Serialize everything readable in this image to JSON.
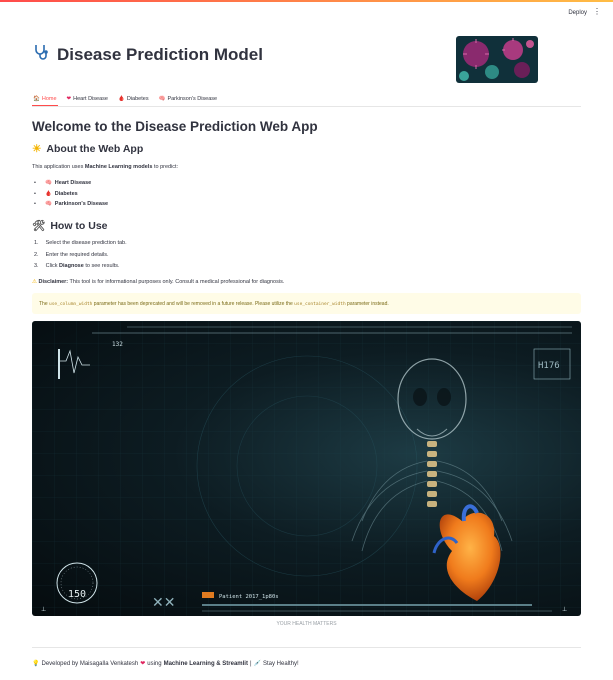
{
  "app": {
    "deploy_label": "Deploy",
    "menu_icon": "kebab-menu-icon",
    "title": "Disease Prediction Model",
    "title_icon": "stethoscope-icon"
  },
  "tabs": [
    {
      "label": "Home",
      "icon": "house-icon",
      "active": true
    },
    {
      "label": "Heart Disease",
      "icon": "heart-icon"
    },
    {
      "label": "Diabetes",
      "icon": "drop-icon"
    },
    {
      "label": "Parkinson's Disease",
      "icon": "brain-icon"
    }
  ],
  "main": {
    "heading": "Welcome to the Disease Prediction Web App",
    "about_heading": "About the Web App",
    "intro_prefix": "This application uses ",
    "intro_bold": "Machine Learning models",
    "intro_suffix": " to predict:",
    "predict_items": [
      "Heart Disease",
      "Diabetes",
      "Parkinson's Disease"
    ],
    "howto_heading": "How to Use",
    "steps": [
      {
        "num": "1.",
        "text": "Select the disease prediction tab."
      },
      {
        "num": "2.",
        "text": "Enter the required details."
      },
      {
        "num": "3.",
        "prefix": "Click ",
        "bold": "Diagnose",
        "suffix": " to see results."
      }
    ],
    "disclaimer_bold": "Disclaimer:",
    "disclaimer_text": " This tool is for informational purposes only. Consult a medical professional for diagnosis."
  },
  "warning": {
    "prefix": "The ",
    "code1": "use_column_width",
    "middle": " parameter has been deprecated and will be removed in a future release. Please utilize the ",
    "code2": "use_container_width",
    "suffix": " parameter instead."
  },
  "hero_image": {
    "hud_top": "132",
    "hud_right": "H176",
    "hud_dial": "150",
    "hud_tag": "Patient 2017_1p80s",
    "caption": "YOUR HEALTH MATTERS"
  },
  "footer": {
    "prefix": "Developed by Maisagalla Venkatesh",
    "middle": " using ",
    "bold": "Machine Learning & Streamlit",
    "separator": " | ",
    "suffix": " Stay Healthy!"
  },
  "colors": {
    "accent": "#ff4b4b",
    "text": "#31333f",
    "warning_bg": "#fffce7"
  }
}
